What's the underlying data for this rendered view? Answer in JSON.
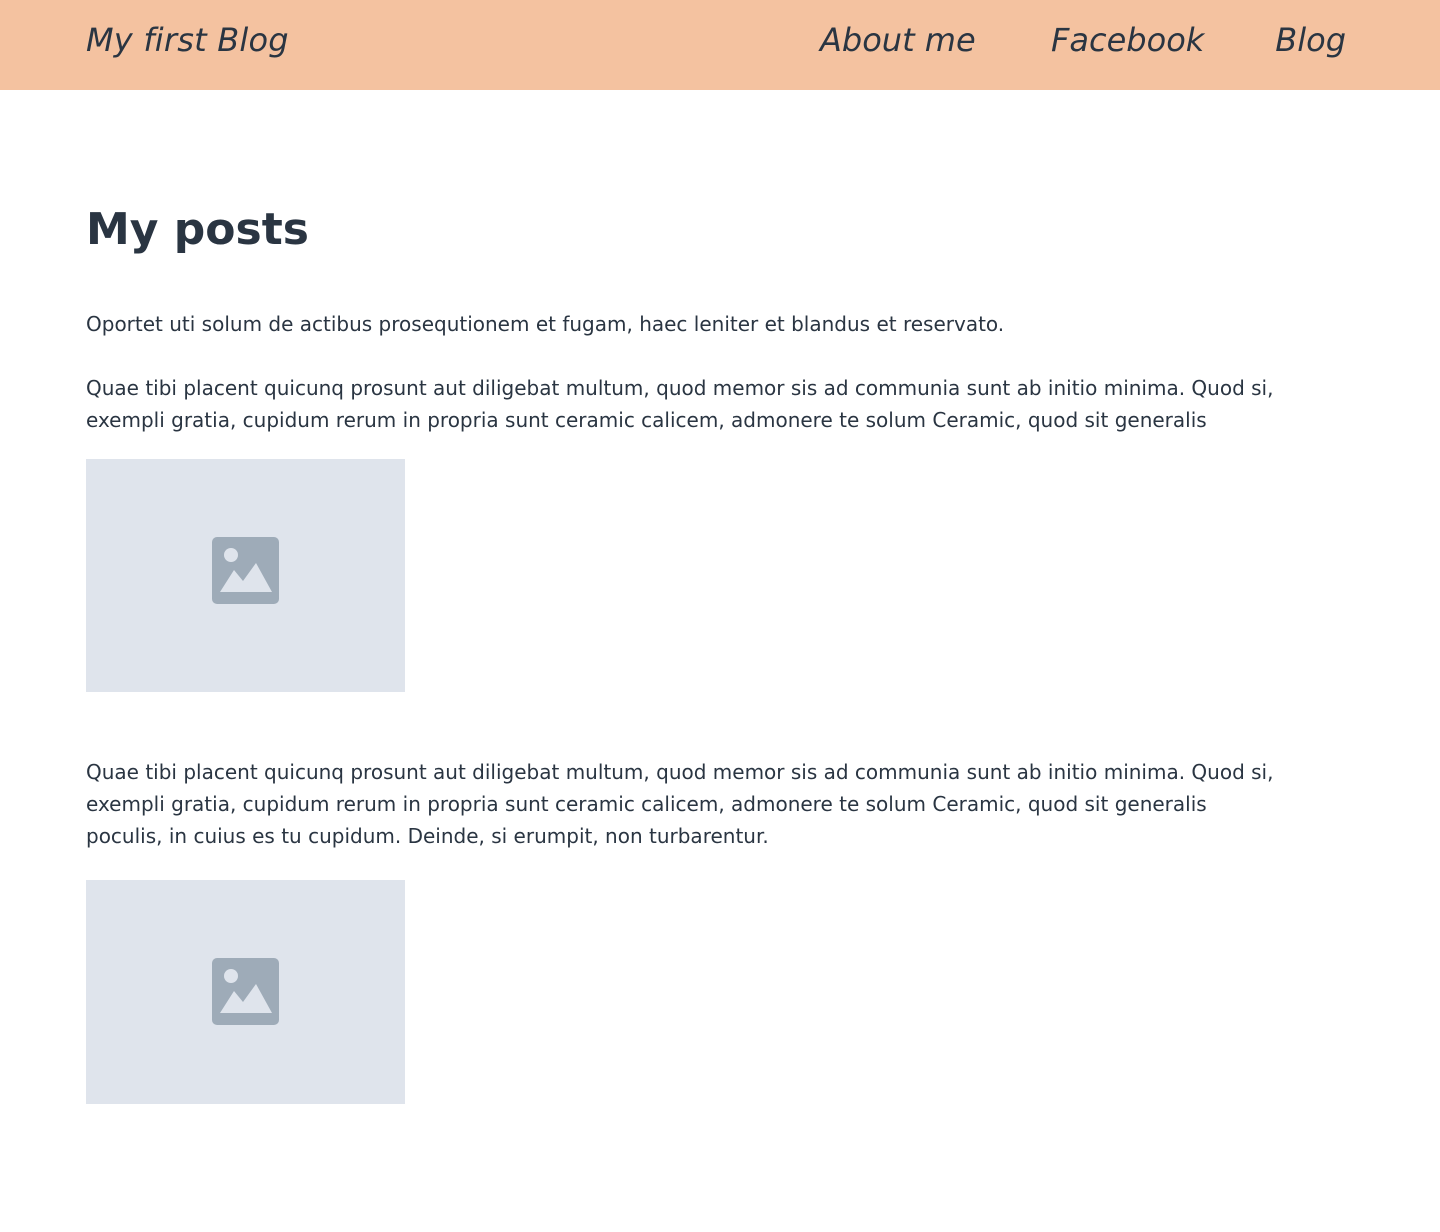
{
  "header": {
    "brand": "My first Blog",
    "nav": {
      "about": "About me",
      "facebook": "Facebook",
      "blog": "Blog"
    },
    "background_color": "#f4c2a0"
  },
  "main": {
    "title": "My posts",
    "intro": "Oportet uti solum de actibus prosequtionem et fugam, haec leniter et blandus et reservato.",
    "posts": [
      {
        "text": "Quae tibi placent quicunq prosunt aut diligebat multum, quod memor sis ad communia sunt ab initio minima. Quod si, exempli gratia, cupidum rerum in propria sunt ceramic calicem, admonere te solum Ceramic, quod sit generalis",
        "image_icon": "image-placeholder-icon"
      },
      {
        "text": "Quae tibi placent quicunq prosunt aut diligebat multum, quod memor sis ad communia sunt ab initio minima. Quod si, exempli gratia, cupidum rerum in propria sunt ceramic calicem, admonere te solum Ceramic, quod sit generalis poculis, in cuius es tu cupidum. Deinde, si erumpit, non turbarentur.",
        "image_icon": "image-placeholder-icon"
      }
    ]
  },
  "colors": {
    "text": "#2a3542",
    "placeholder_bg": "#dfe4ec",
    "placeholder_icon": "#9eabb8"
  }
}
